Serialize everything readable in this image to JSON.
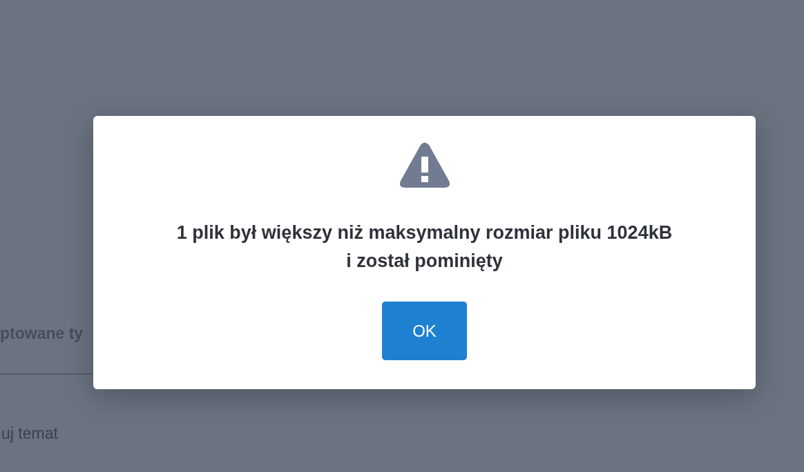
{
  "background": {
    "section_label": "ptowane ty",
    "link": "uj temat"
  },
  "dialog": {
    "kind": "warning",
    "message_lines": [
      "1 plik był większy niż maksymalny rozmiar pliku 1024kB",
      "i został pominięty"
    ],
    "button": "OK"
  }
}
